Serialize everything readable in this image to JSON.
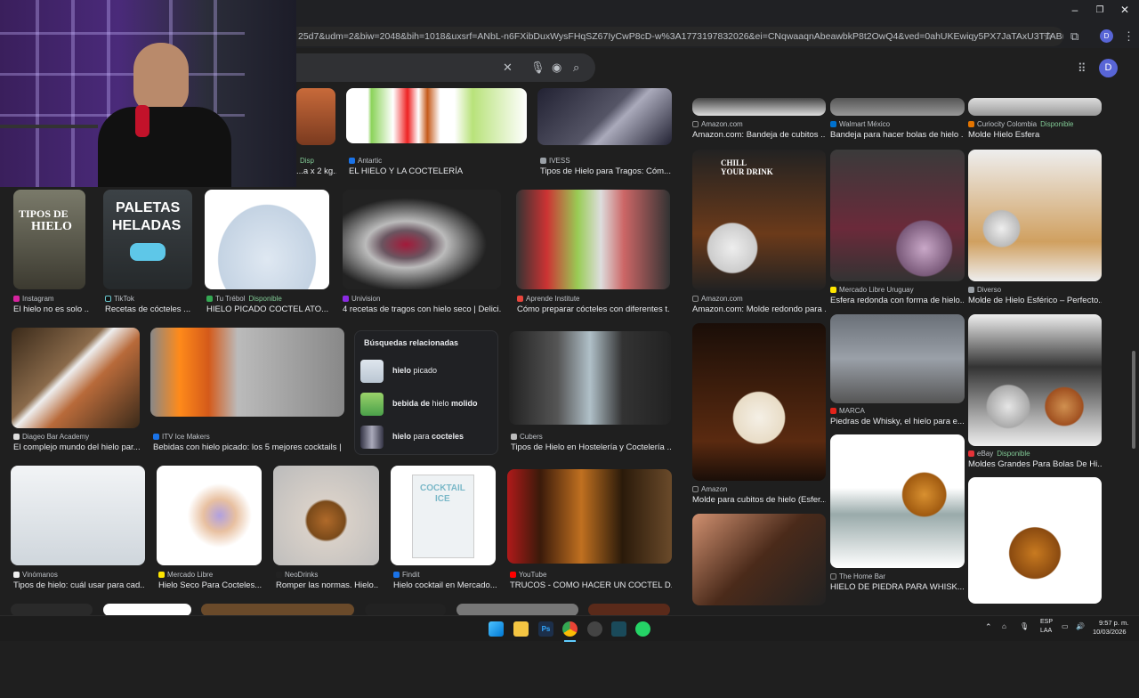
{
  "browser": {
    "url": "25d7&udm=2&biw=2048&bih=1018&uxsrf=ANbL-n6FXibDuxWysFHqSZ67IyCwP8cD-w%3A1773197832026&ei=CNqwaaqnAbeawbkP8t2OwQ4&ved=0ahUKEwiqy5PX7JaTAxU3TTABHfKul-gQ4dUDCBI&uact=5&oq...",
    "profile_initial": "D",
    "account_initial": "D",
    "window_controls": {
      "minimize": "–",
      "maximize": "❐",
      "close": "✕"
    }
  },
  "search": {
    "clear": "✕"
  },
  "results": [
    {
      "id": "r1",
      "src": "",
      "cap": "...a x 2 kg...",
      "avail": "Disp"
    },
    {
      "id": "r2",
      "src": "Antartic",
      "cap": "EL HIELO Y LA COCTELERÍA"
    },
    {
      "id": "r3",
      "src": "IVESS",
      "cap": "Tipos de Hielo para Tragos: Cóm..."
    },
    {
      "id": "r4",
      "src": "Amazon.com",
      "cap": "Amazon.com: Bandeja de cubitos ..."
    },
    {
      "id": "r5",
      "src": "Walmart México",
      "cap": "Bandeja para hacer bolas de hielo ..."
    },
    {
      "id": "r6",
      "src": "Curiocity Colombia",
      "cap": "Molde Hielo Esfera",
      "avail": "Disponible"
    },
    {
      "id": "r7",
      "src": "Instagram",
      "cap": "El hielo no es solo ...",
      "label1": "TIPOS DE",
      "label2": "HIELO"
    },
    {
      "id": "r8",
      "src": "TikTok",
      "cap": "Recetas de cócteles ...",
      "label1": "PALETAS",
      "label2": "HELADAS"
    },
    {
      "id": "r9",
      "src": "Tu Trébol",
      "cap": "HIELO PICADO COCTEL ATO...",
      "avail": "Disponible"
    },
    {
      "id": "r10",
      "src": "Univision",
      "cap": "4 recetas de tragos con hielo seco | Delici..."
    },
    {
      "id": "r11",
      "src": "Aprende Institute",
      "cap": "Cómo preparar cócteles con diferentes t..."
    },
    {
      "id": "r12",
      "src": "Amazon.com",
      "cap": "Amazon.com: Molde redondo para ...",
      "label1": "CHILL",
      "label2": "YOUR DRINK"
    },
    {
      "id": "r13",
      "src": "Mercado Libre Uruguay",
      "cap": "Esfera redonda con forma de hielo..."
    },
    {
      "id": "r14",
      "src": "Diverso",
      "cap": "Molde de Hielo Esférico – Perfecto..."
    },
    {
      "id": "r15",
      "src": "Diageo Bar Academy",
      "cap": "El complejo mundo del hielo par..."
    },
    {
      "id": "r16",
      "src": "ITV Ice Makers",
      "cap": "Bebidas con hielo picado: los 5 mejores cocktails | ..."
    },
    {
      "id": "r17",
      "src": "Cubers",
      "cap": "Tipos de Hielo en Hostelería y Coctelería ..."
    },
    {
      "id": "r18",
      "src": "Amazon",
      "cap": "Molde para cubitos de hielo (Esfer..."
    },
    {
      "id": "r19",
      "src": "MARCA",
      "cap": "Piedras de Whisky, el hielo para e..."
    },
    {
      "id": "r20",
      "src": "eBay",
      "cap": "Moldes Grandes Para Bolas De Hi...",
      "avail": "Disponible"
    },
    {
      "id": "r21",
      "src": "Vinómanos",
      "cap": "Tipos de hielo: cuál usar para cad..."
    },
    {
      "id": "r22",
      "src": "Mercado Libre",
      "cap": "Hielo Seco Para Cocteles..."
    },
    {
      "id": "r23",
      "src": "NeoDrinks",
      "cap": "Romper las normas. Hielo..."
    },
    {
      "id": "r24",
      "src": "Findit",
      "cap": "Hielo cocktail en Mercado...",
      "label1": "COCKTAIL",
      "label2": "ICE"
    },
    {
      "id": "r25",
      "src": "YouTube",
      "cap": "TRUCOS - COMO HACER UN COCTEL D..."
    },
    {
      "id": "r26",
      "src": "The Home Bar",
      "cap": "HIELO DE PIEDRA PARA WHISK..."
    }
  ],
  "related": {
    "title": "Búsquedas relacionadas",
    "items": [
      {
        "bold": "hielo",
        "rest": " picado"
      },
      {
        "bold": "bebida de",
        "rest": " hielo ",
        "bold2": "molido"
      },
      {
        "bold": "hielo",
        "rest": " para ",
        "bold2": "cocteles"
      }
    ]
  },
  "taskbar": {
    "lang1": "ESP",
    "lang2": "LAA",
    "time": "9:57 p. m.",
    "date": "10/03/2026"
  },
  "colors": {
    "bg": "#1f1f1f",
    "accent_green": "#81c995",
    "profile": "#5865d6"
  },
  "icons": [
    "close-icon",
    "microphone-icon",
    "lens-icon",
    "search-icon",
    "apps-grid-icon",
    "star-icon",
    "extensions-icon",
    "windows-start-icon",
    "file-explorer-icon",
    "chrome-icon",
    "photoshop-icon",
    "whatsapp-icon"
  ]
}
